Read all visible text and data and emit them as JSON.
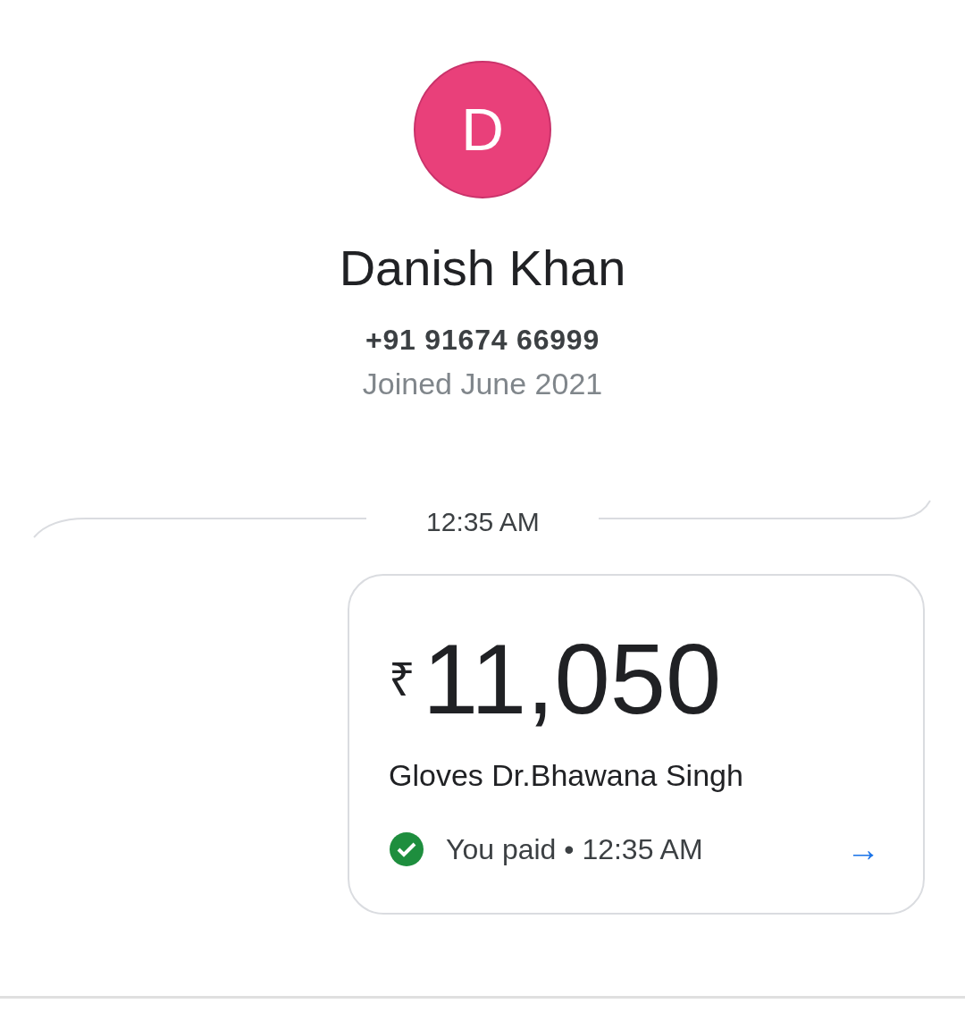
{
  "contact": {
    "initial": "D",
    "name": "Danish Khan",
    "phone": "+91 91674 66999",
    "joined": "Joined June 2021"
  },
  "timestamp": "12:35 AM",
  "payment": {
    "currency": "₹",
    "amount": "11,050",
    "note": "Gloves Dr.Bhawana Singh",
    "status": "You paid • 12:35 AM",
    "completed": true,
    "arrow": "→"
  }
}
